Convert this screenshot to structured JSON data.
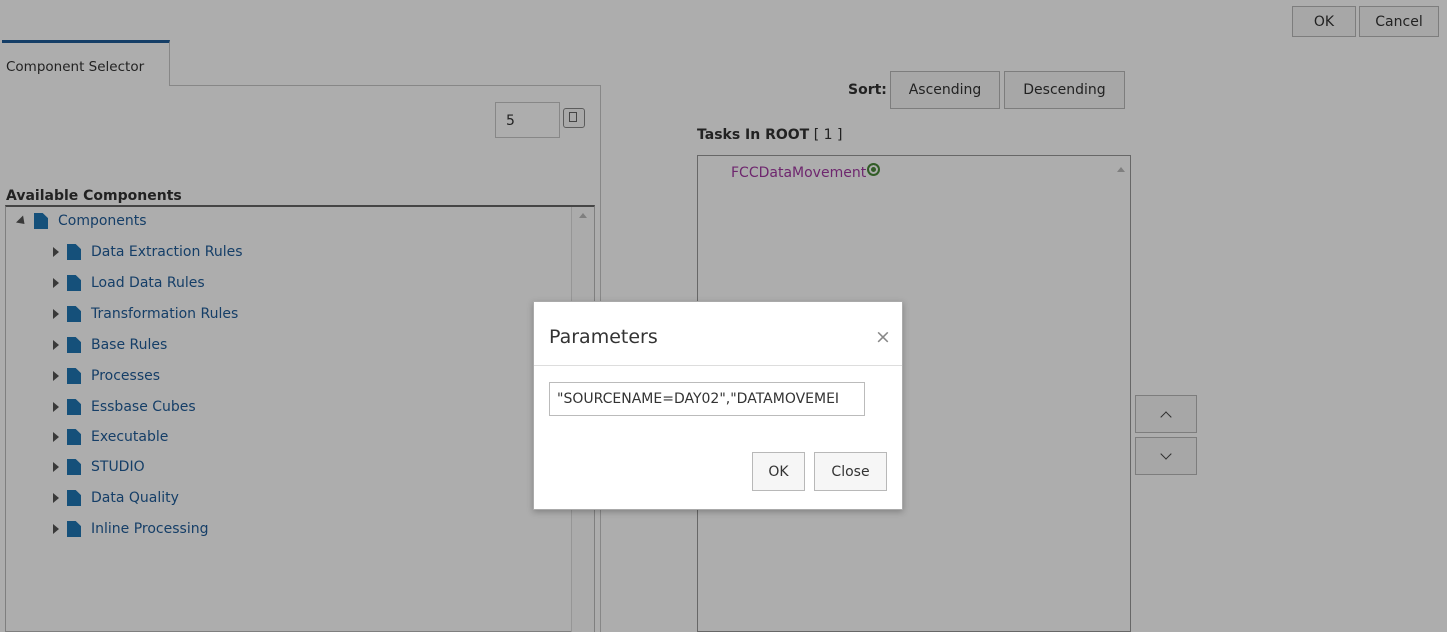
{
  "toolbar": {
    "ok_label": "OK",
    "cancel_label": "Cancel"
  },
  "tab": {
    "label": "Component Selector"
  },
  "spinner": {
    "value": "5"
  },
  "available": {
    "heading": "Available Components",
    "root": "Components",
    "items": [
      "Data Extraction Rules",
      "Load Data Rules",
      "Transformation Rules",
      "Base Rules",
      "Processes",
      "Essbase Cubes",
      "Executable",
      "STUDIO",
      "Data Quality",
      "Inline Processing"
    ]
  },
  "sort": {
    "label": "Sort:",
    "ascending": "Ascending",
    "descending": "Descending"
  },
  "tasks": {
    "heading": "Tasks In ROOT",
    "count": "[ 1 ]",
    "items": [
      "FCCDataMovement"
    ]
  },
  "modal": {
    "title": "Parameters",
    "close_glyph": "×",
    "param_value": "\"SOURCENAME=DAY02\",\"DATAMOVEMEI",
    "ok_label": "OK",
    "close_label": "Close"
  },
  "colors": {
    "accent": "#1f5c99",
    "task_text": "#a33aa3",
    "overlay": "rgba(0,0,0,0.32)"
  },
  "icons": {
    "doc": "document-icon",
    "gear": "gear-icon"
  }
}
